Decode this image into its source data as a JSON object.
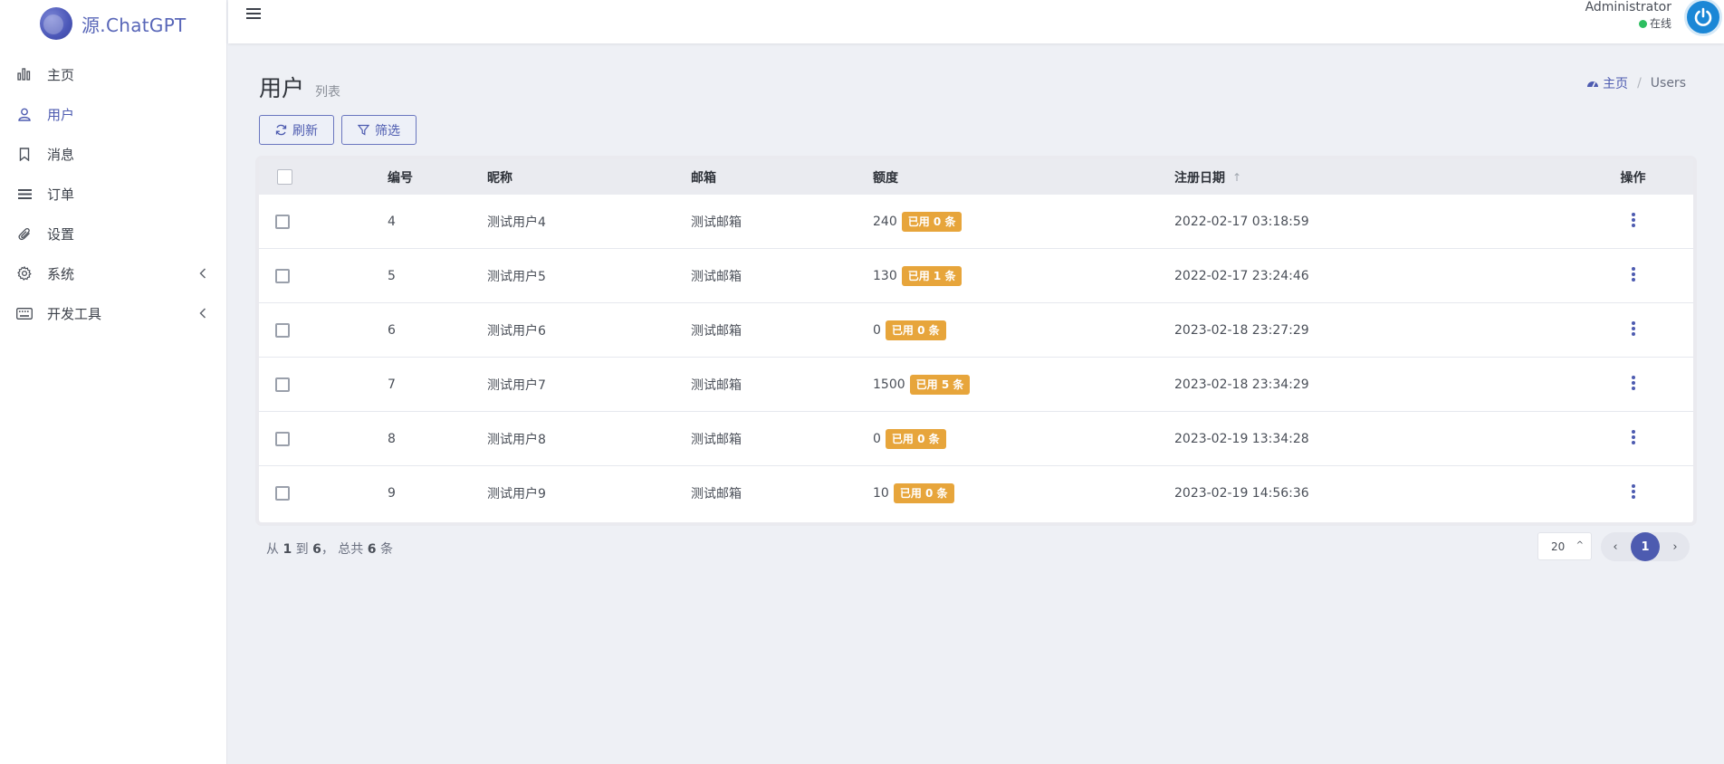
{
  "brand": {
    "name": "源.ChatGPT",
    "logo_icon": "logo-icon"
  },
  "sidebar": {
    "items": [
      {
        "label": "主页",
        "icon": "bar-chart-icon",
        "active": false,
        "has_submenu": false
      },
      {
        "label": "用户",
        "icon": "user-icon",
        "active": true,
        "has_submenu": false
      },
      {
        "label": "消息",
        "icon": "bookmark-icon",
        "active": false,
        "has_submenu": false
      },
      {
        "label": "订单",
        "icon": "list-icon",
        "active": false,
        "has_submenu": false
      },
      {
        "label": "设置",
        "icon": "paperclip-icon",
        "active": false,
        "has_submenu": false
      },
      {
        "label": "系统",
        "icon": "gear-icon",
        "active": false,
        "has_submenu": true
      },
      {
        "label": "开发工具",
        "icon": "keyboard-icon",
        "active": false,
        "has_submenu": true
      }
    ]
  },
  "topbar": {
    "user_name": "Administrator",
    "status": "在线",
    "status_color": "#2dbe60"
  },
  "header": {
    "title": "用户",
    "subtitle": "列表"
  },
  "breadcrumb": {
    "home": "主页",
    "separator": "/",
    "current": "Users"
  },
  "toolbar": {
    "refresh_label": "刷新",
    "filter_label": "筛选"
  },
  "table": {
    "columns": {
      "id": "编号",
      "nickname": "昵称",
      "email": "邮箱",
      "quota": "额度",
      "reg_date": "注册日期",
      "ops": "操作"
    },
    "rows": [
      {
        "id": "4",
        "nickname": "测试用户4",
        "email": "测试邮箱",
        "quota": "240",
        "used": "已用 0 条",
        "reg_date": "2022-02-17 03:18:59"
      },
      {
        "id": "5",
        "nickname": "测试用户5",
        "email": "测试邮箱",
        "quota": "130",
        "used": "已用 1 条",
        "reg_date": "2022-02-17 23:24:46"
      },
      {
        "id": "6",
        "nickname": "测试用户6",
        "email": "测试邮箱",
        "quota": "0",
        "used": "已用 0 条",
        "reg_date": "2023-02-18 23:27:29"
      },
      {
        "id": "7",
        "nickname": "测试用户7",
        "email": "测试邮箱",
        "quota": "1500",
        "used": "已用 5 条",
        "reg_date": "2023-02-18 23:34:29"
      },
      {
        "id": "8",
        "nickname": "测试用户8",
        "email": "测试邮箱",
        "quota": "0",
        "used": "已用 0 条",
        "reg_date": "2023-02-19 13:34:28"
      },
      {
        "id": "9",
        "nickname": "测试用户9",
        "email": "测试邮箱",
        "quota": "10",
        "used": "已用 0 条",
        "reg_date": "2023-02-19 14:56:36"
      }
    ]
  },
  "footer": {
    "summary_from_label": "从",
    "from": "1",
    "to_label": "到",
    "to": "6",
    "total_label": "， 总共",
    "total": "6",
    "unit": "条",
    "per_page": "20",
    "current_page": "1"
  },
  "colors": {
    "accent": "#4d5bb0",
    "badge": "#e7a53b"
  }
}
